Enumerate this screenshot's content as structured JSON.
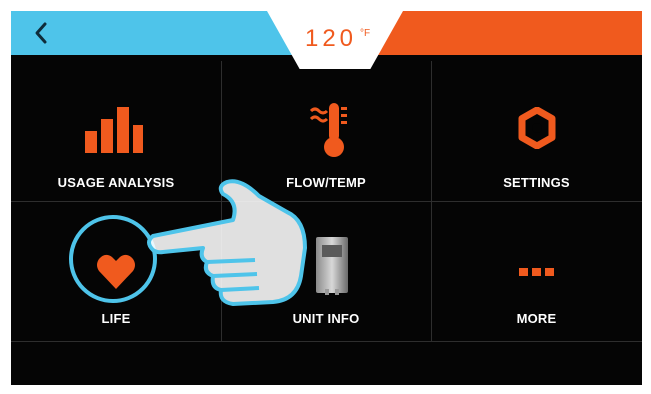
{
  "header": {
    "back_icon": "chevron-left-icon",
    "temperature": "120",
    "temperature_unit": "°F",
    "left_color": "#4ec4ea",
    "right_color": "#f05a1e"
  },
  "tiles": [
    {
      "label": "USAGE ANALYSIS",
      "icon": "bar-chart-icon"
    },
    {
      "label": "FLOW/TEMP",
      "icon": "thermometer-icon"
    },
    {
      "label": "SETTINGS",
      "icon": "gear-icon"
    },
    {
      "label": "LIFE",
      "icon": "heart-icon"
    },
    {
      "label": "UNIT INFO",
      "icon": "water-heater-unit-icon"
    },
    {
      "label": "MORE",
      "icon": "more-dots-icon"
    }
  ],
  "overlay": {
    "hand_icon": "pointing-hand-icon",
    "highlight": "LIFE"
  },
  "accent_color": "#f05a1e"
}
